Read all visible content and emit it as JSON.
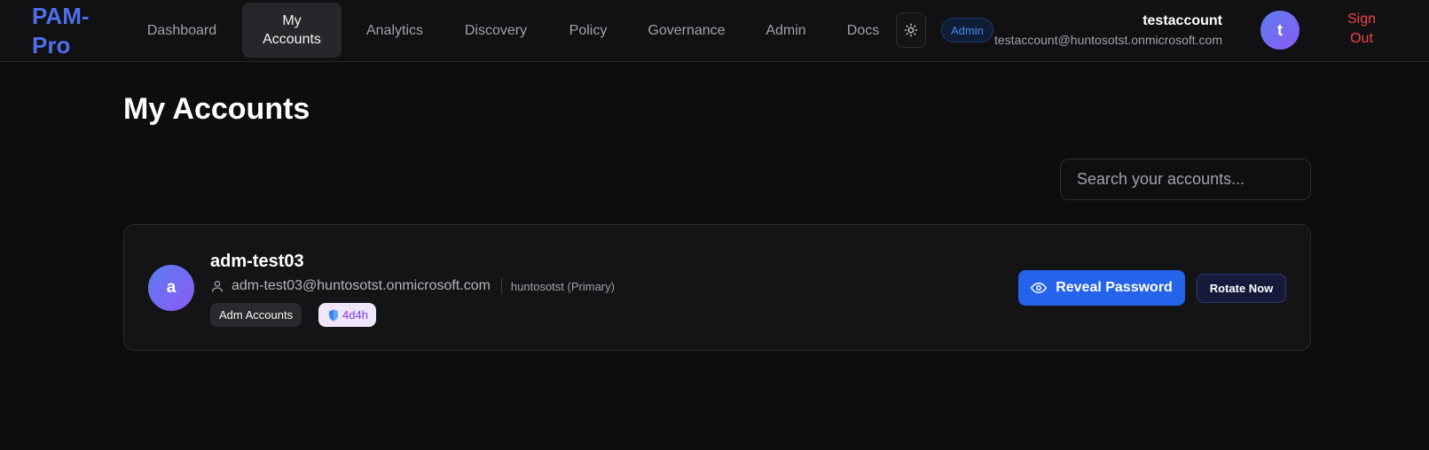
{
  "brand": {
    "name": "PAM-Pro"
  },
  "nav": {
    "items": [
      {
        "label": "Dashboard"
      },
      {
        "label": "My Accounts"
      },
      {
        "label": "Analytics"
      },
      {
        "label": "Discovery"
      },
      {
        "label": "Policy"
      },
      {
        "label": "Governance"
      },
      {
        "label": "Admin"
      },
      {
        "label": "Docs"
      }
    ],
    "active": "My Accounts"
  },
  "theme_toggle": {
    "icon": "sun-icon"
  },
  "role_badge": {
    "label": "Admin"
  },
  "user": {
    "name": "testaccount",
    "email": "testaccount@huntosotst.onmicrosoft.com",
    "initial": "t"
  },
  "sign_out": {
    "label": "Sign Out"
  },
  "page": {
    "title": "My Accounts"
  },
  "search": {
    "placeholder": "Search your accounts...",
    "value": ""
  },
  "accounts": [
    {
      "initial": "a",
      "name": "adm-test03",
      "email": "adm-test03@huntosotst.onmicrosoft.com",
      "domain": "huntosotst (Primary)",
      "group_tag": "Adm Accounts",
      "duration_tag": "4d4h",
      "reveal_label": "Reveal Password",
      "rotate_label": "Rotate Now"
    }
  ],
  "colors": {
    "accent": "#2563eb",
    "brand": "#4f6fe8",
    "danger": "#ef4444",
    "duration_text": "#7c3aed"
  }
}
